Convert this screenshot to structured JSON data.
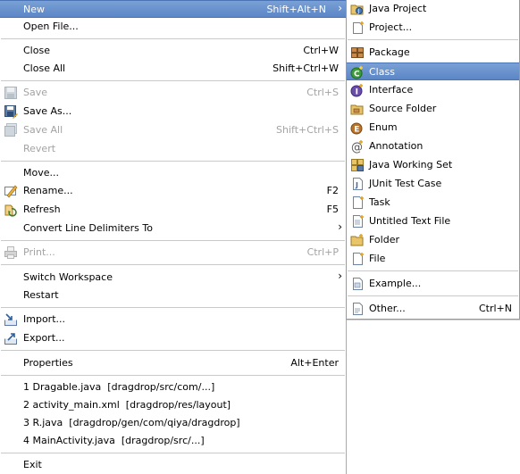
{
  "file_menu": {
    "new": {
      "label": "New",
      "shortcut": "Shift+Alt+N"
    },
    "open_file": {
      "label": "Open File..."
    },
    "close": {
      "label": "Close",
      "shortcut": "Ctrl+W"
    },
    "close_all": {
      "label": "Close All",
      "shortcut": "Shift+Ctrl+W"
    },
    "save": {
      "label": "Save",
      "shortcut": "Ctrl+S"
    },
    "save_as": {
      "label": "Save As..."
    },
    "save_all": {
      "label": "Save All",
      "shortcut": "Shift+Ctrl+S"
    },
    "revert": {
      "label": "Revert"
    },
    "move": {
      "label": "Move..."
    },
    "rename": {
      "label": "Rename...",
      "shortcut": "F2"
    },
    "refresh": {
      "label": "Refresh",
      "shortcut": "F5"
    },
    "convert": {
      "label": "Convert Line Delimiters To"
    },
    "print": {
      "label": "Print...",
      "shortcut": "Ctrl+P"
    },
    "switch_workspace": {
      "label": "Switch Workspace"
    },
    "restart": {
      "label": "Restart"
    },
    "import": {
      "label": "Import..."
    },
    "export": {
      "label": "Export..."
    },
    "properties": {
      "label": "Properties",
      "shortcut": "Alt+Enter"
    },
    "recent": [
      {
        "label": "1 Dragable.java  [dragdrop/src/com/...]"
      },
      {
        "label": "2 activity_main.xml  [dragdrop/res/layout]"
      },
      {
        "label": "3 R.java  [dragdrop/gen/com/qiya/dragdrop]"
      },
      {
        "label": "4 MainActivity.java  [dragdrop/src/...]"
      }
    ],
    "exit": {
      "label": "Exit"
    }
  },
  "new_submenu": {
    "java_project": {
      "label": "Java Project"
    },
    "project": {
      "label": "Project..."
    },
    "package": {
      "label": "Package"
    },
    "class": {
      "label": "Class"
    },
    "interface": {
      "label": "Interface"
    },
    "source_folder": {
      "label": "Source Folder"
    },
    "enum": {
      "label": "Enum"
    },
    "annotation": {
      "label": "Annotation"
    },
    "java_working_set": {
      "label": "Java Working Set"
    },
    "junit_test_case": {
      "label": "JUnit Test Case"
    },
    "task": {
      "label": "Task"
    },
    "untitled_text_file": {
      "label": "Untitled Text File"
    },
    "folder": {
      "label": "Folder"
    },
    "file": {
      "label": "File"
    },
    "example": {
      "label": "Example..."
    },
    "other": {
      "label": "Other...",
      "shortcut": "Ctrl+N"
    }
  },
  "colors": {
    "highlight": "#5b86c6",
    "disabled_text": "#a3a3a3",
    "separator": "#c9c9c9"
  },
  "icons": {
    "save": "save-icon",
    "save_as": "save-as-icon",
    "save_all": "save-all-icon",
    "rename": "rename-icon",
    "refresh": "refresh-icon",
    "print": "print-icon",
    "import": "import-icon",
    "export": "export-icon",
    "java_project": "java-project-icon",
    "project": "project-icon",
    "package": "package-icon",
    "class": "class-icon",
    "interface": "interface-icon",
    "source_folder": "source-folder-icon",
    "enum": "enum-icon",
    "annotation": "annotation-icon",
    "java_working_set": "working-set-icon",
    "junit_test_case": "junit-icon",
    "task": "task-icon",
    "untitled_text_file": "text-file-icon",
    "folder": "folder-icon",
    "file": "file-icon",
    "example": "example-icon",
    "other": "other-icon"
  }
}
